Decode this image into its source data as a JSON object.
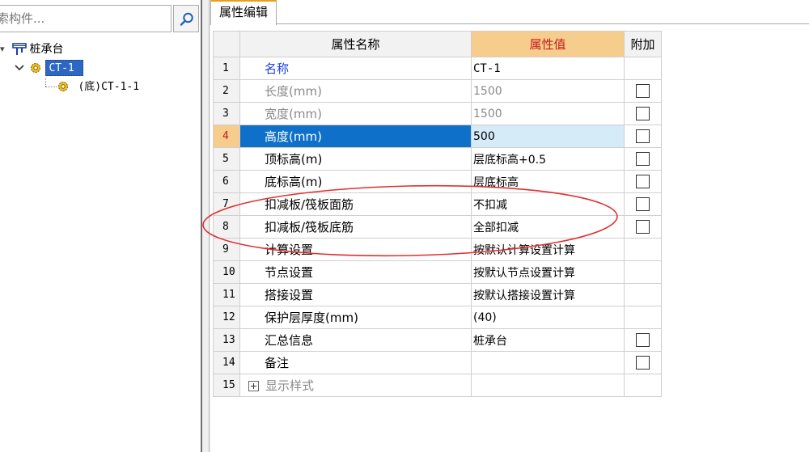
{
  "search": {
    "placeholder": "索构件..."
  },
  "tree": {
    "root": {
      "label": "桩承台"
    },
    "child": {
      "label": "CT-1"
    },
    "grandchild": {
      "label": "(底)CT-1-1"
    }
  },
  "tabs": [
    {
      "label": "属性编辑"
    }
  ],
  "table": {
    "headers": {
      "num": "",
      "name": "属性名称",
      "value": "属性值",
      "add": "附加"
    },
    "rows": [
      {
        "num": "1",
        "name": "名称",
        "value": "CT-1",
        "checkbox": false
      },
      {
        "num": "2",
        "name": "长度(mm)",
        "value": "1500",
        "checkbox": true
      },
      {
        "num": "3",
        "name": "宽度(mm)",
        "value": "1500",
        "checkbox": true
      },
      {
        "num": "4",
        "name": "高度(mm)",
        "value": "500",
        "checkbox": true
      },
      {
        "num": "5",
        "name": "顶标高(m)",
        "value": "层底标高+0.5",
        "checkbox": true
      },
      {
        "num": "6",
        "name": "底标高(m)",
        "value": "层底标高",
        "checkbox": true
      },
      {
        "num": "7",
        "name": "扣减板/筏板面筋",
        "value": "不扣减",
        "checkbox": true
      },
      {
        "num": "8",
        "name": "扣减板/筏板底筋",
        "value": "全部扣减",
        "checkbox": true
      },
      {
        "num": "9",
        "name": "计算设置",
        "value": "按默认计算设置计算",
        "checkbox": false
      },
      {
        "num": "10",
        "name": "节点设置",
        "value": "按默认节点设置计算",
        "checkbox": false
      },
      {
        "num": "11",
        "name": "搭接设置",
        "value": "按默认搭接设置计算",
        "checkbox": false
      },
      {
        "num": "12",
        "name": "保护层厚度(mm)",
        "value": "(40)",
        "checkbox": false
      },
      {
        "num": "13",
        "name": "汇总信息",
        "value": "桩承台",
        "checkbox": true
      },
      {
        "num": "14",
        "name": "备注",
        "value": "",
        "checkbox": true
      },
      {
        "num": "15",
        "name": "显示样式",
        "value": "",
        "checkbox": false
      }
    ]
  },
  "colors": {
    "selection_blue": "#0e70c9",
    "value_header_orange": "#f6cd8c",
    "value_header_text": "#c51a1a",
    "annotation_red": "#e03030",
    "link_blue": "#1a3ee8"
  },
  "icons": [
    "search-icon",
    "pile-cap-icon",
    "chevron-down-icon",
    "gear-icon",
    "expand-plus-icon"
  ]
}
